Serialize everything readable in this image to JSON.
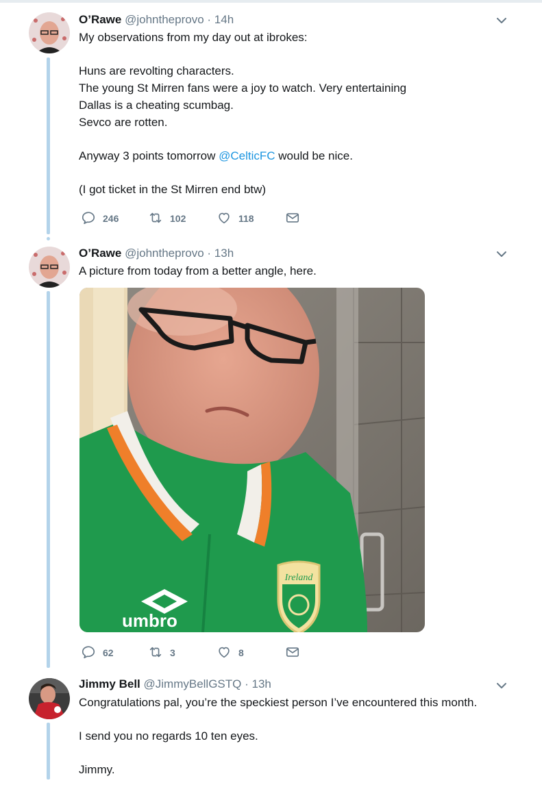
{
  "tweets": [
    {
      "name": "O’Rawe",
      "handle": "@johntheprovo",
      "separator": "·",
      "time": "14h",
      "lines": [
        "My observations from my day out at ibrokes:",
        "",
        "Huns are revolting characters.",
        "The young St Mirren fans were a joy to watch. Very entertaining",
        "Dallas is a cheating scumbag.",
        "Sevco are rotten.",
        "",
        "Anyway 3 points tomorrow ",
        "",
        "(I got ticket in the St Mirren end btw)"
      ],
      "mention": "@CelticFC",
      "mention_suffix": " would be nice.",
      "replies": "246",
      "retweets": "102",
      "likes": "118"
    },
    {
      "name": "O’Rawe",
      "handle": "@johntheprovo",
      "separator": "·",
      "time": "13h",
      "text": "A picture from today from a better angle, here.",
      "replies": "62",
      "retweets": "3",
      "likes": "8",
      "photo": {
        "badge_text": "Ireland",
        "brand_text": "umbro"
      }
    },
    {
      "name": "Jimmy Bell",
      "handle": "@JimmyBellGSTQ",
      "separator": "·",
      "time": "13h",
      "lines": [
        "Congratulations pal, you’re the speckiest person I’ve encountered this month.",
        "",
        "I send you no regards 10 ten eyes.",
        "",
        "Jimmy."
      ]
    }
  ],
  "colors": {
    "link": "#1b95e0",
    "muted": "#657786",
    "thread": "#b3d3ea",
    "jersey": "#1f9a4d"
  },
  "icons": [
    "reply-icon",
    "retweet-icon",
    "like-icon",
    "direct-message-icon",
    "chevron-down-icon"
  ]
}
